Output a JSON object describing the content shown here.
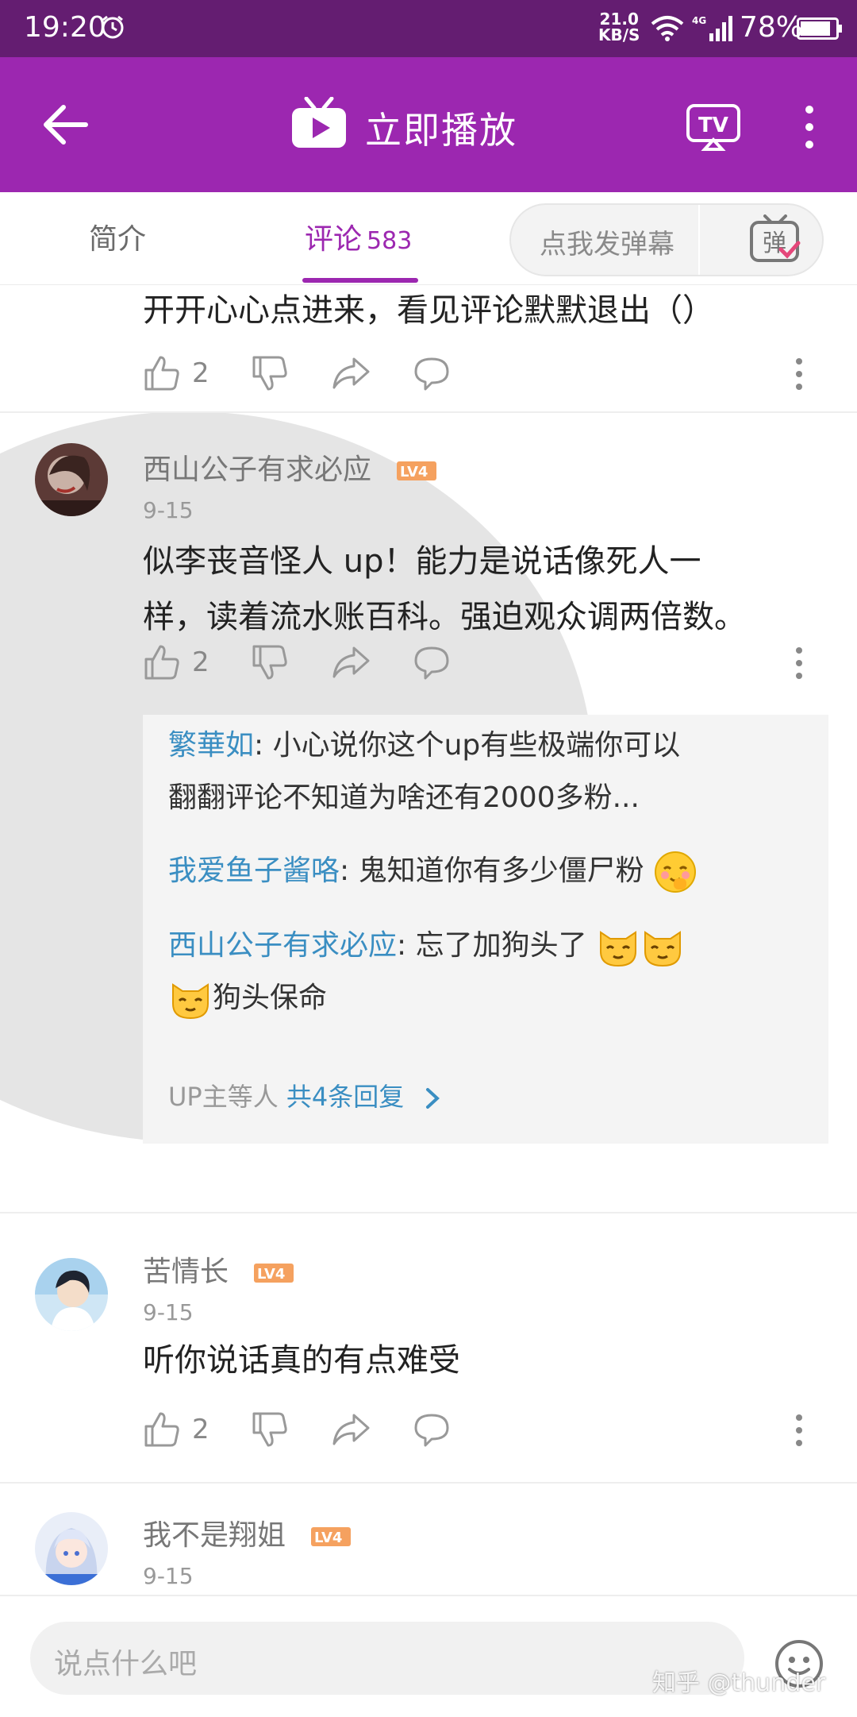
{
  "status_bar": {
    "time": "19:20",
    "net_speed_value": "21.0",
    "net_speed_unit": "KB/S",
    "network_type": "4G",
    "battery": "78%"
  },
  "app_bar": {
    "title": "立即播放"
  },
  "tabs": {
    "intro": "简介",
    "comments": "评论",
    "comments_count": "583",
    "danmaku_placeholder": "点我发弹幕",
    "danmaku_icon_glyph": "弹"
  },
  "comments": [
    {
      "text": "开开心心点进来，看见评论默默退出（）",
      "likes": "2"
    },
    {
      "username": "西山公子有求必应",
      "level": "LV4",
      "date": "9-15",
      "text_line1": "似李丧音怪人 up！能力是说话像死人一",
      "text_line2": "样，读着流水账百科。强迫观众调两倍数。",
      "likes": "2",
      "replies": [
        {
          "name": "繁華如",
          "text_line1": ": 小心说你这个up有些极端你可以",
          "text_line2": "翻翻评论不知道为啥还有2000多粉..."
        },
        {
          "name": "我爱鱼子酱咯",
          "text": ": 鬼知道你有多少僵尸粉"
        },
        {
          "name": "西山公子有求必应",
          "text": ": 忘了加狗头了",
          "text_line2": "狗头保命"
        }
      ],
      "reply_summary_prefix": "UP主等人 ",
      "reply_summary_link": "共4条回复"
    },
    {
      "username": "苦情长",
      "level": "LV4",
      "date": "9-15",
      "text": "听你说话真的有点难受",
      "likes": "2"
    },
    {
      "username": "我不是翔姐",
      "level": "LV4",
      "date": "9-15"
    }
  ],
  "input": {
    "placeholder": "说点什么吧"
  },
  "watermark": "知乎 @thunder",
  "colors": {
    "status_bar": "#641d71",
    "app_bar": "#9c27b0",
    "accent": "#9c27b0",
    "reply_name": "#3a8ec2",
    "level_badge": "#f5a15f"
  }
}
